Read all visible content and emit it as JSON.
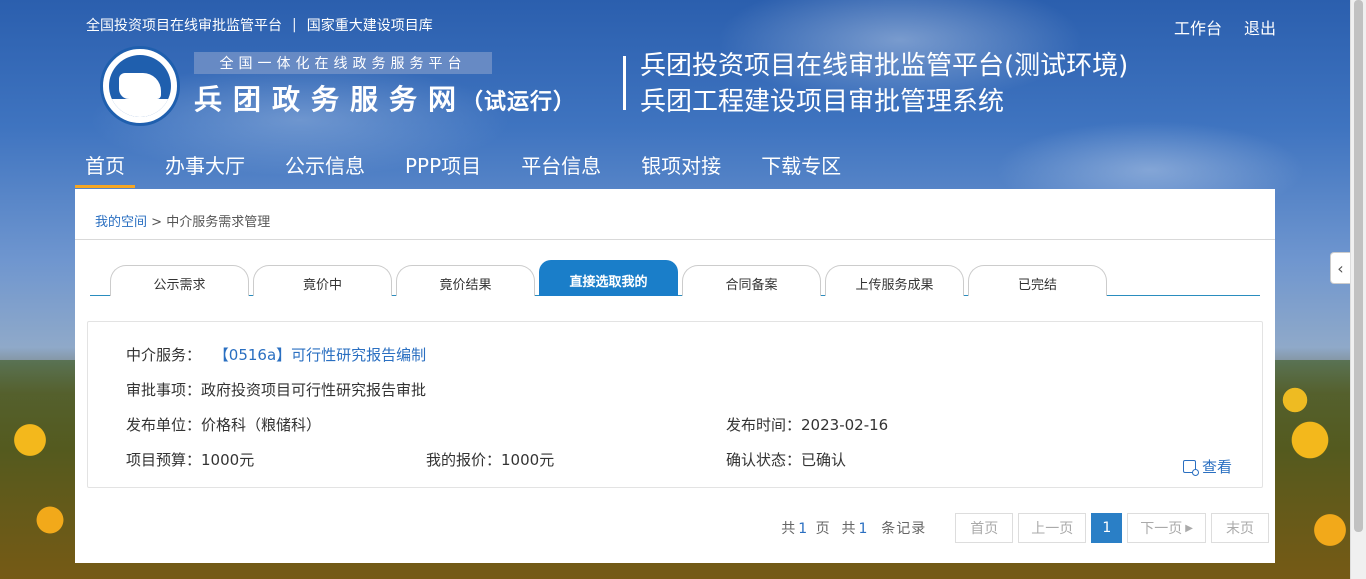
{
  "header": {
    "top_links": [
      "全国投资项目在线审批监管平台",
      "国家重大建设项目库"
    ],
    "separator": "|",
    "user_links": [
      "工作台",
      "退出"
    ],
    "slogan": "全国一体化在线政务服务平台",
    "site_name": "兵团政务服务网",
    "site_suffix": "（试运行）",
    "platform_title_line1": "兵团投资项目在线审批监管平台(测试环境)",
    "platform_title_line2": "兵团工程建设项目审批管理系统"
  },
  "nav": {
    "items": [
      "首页",
      "办事大厅",
      "公示信息",
      "PPP项目",
      "平台信息",
      "银项对接",
      "下载专区"
    ],
    "active": "首页"
  },
  "breadcrumb": {
    "home": "我的空间",
    "separator": ">",
    "current": "中介服务需求管理"
  },
  "tabs": {
    "items": [
      "公示需求",
      "竟价中",
      "竟价结果",
      "直接选取我的",
      "合同备案",
      "上传服务成果",
      "已完结"
    ],
    "active": "直接选取我的"
  },
  "record": {
    "service_label": "中介服务：",
    "service_value": "【0516a】可行性研究报告编制",
    "approval_label": "审批事项：",
    "approval_value": "政府投资项目可行性研究报告审批",
    "publisher_label": "发布单位：",
    "publisher_value": "价格科（粮储科）",
    "publish_time_label": "发布时间：",
    "publish_time_value": "2023-02-16",
    "budget_label": "项目预算：",
    "budget_value": "1000元",
    "my_quote_label": "我的报价：",
    "my_quote_value": "1000元",
    "confirm_label": "确认状态：",
    "confirm_value": "已确认",
    "view_label": "查看"
  },
  "pagination": {
    "total_prefix": "共",
    "total_pages": "1",
    "pages_unit": "页",
    "records_prefix": "共",
    "total_records": "1",
    "records_unit": "条记录",
    "first": "首页",
    "prev": "上一页",
    "current": "1",
    "next": "下一页",
    "last": "末页"
  },
  "colors": {
    "accent": "#1a7ec9",
    "link": "#2a6fc1",
    "nav_active_underline": "#f5a623"
  }
}
